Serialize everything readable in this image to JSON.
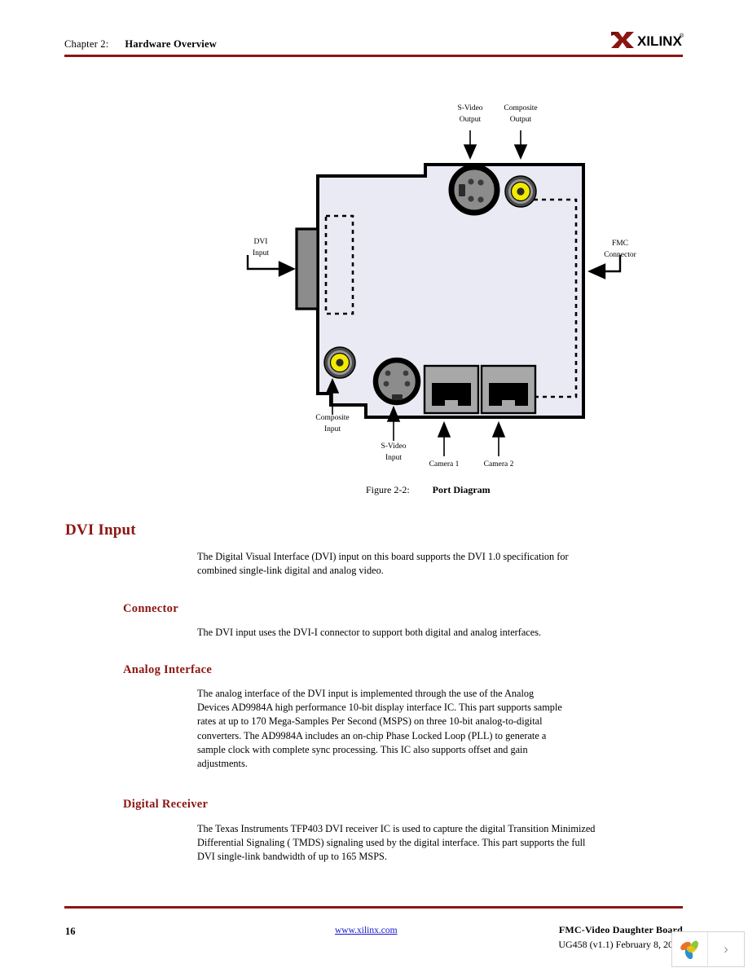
{
  "header": {
    "chapter_label": "Chapter 2:",
    "chapter_title": "Hardware Overview",
    "logo_text": "XILINX",
    "logo_trademark": "®",
    "rule_color": "#8c1512"
  },
  "figure": {
    "caption_number": "Figure 2-2:",
    "caption_title": "Port Diagram",
    "labels": {
      "svideo_output": "S-Video\nOutput",
      "composite_output": "Composite\nOutput",
      "dvi_input": "DVI\nInput",
      "fmc_connector": "FMC\nConnector",
      "composite_input": "Composite\nInput",
      "svideo_input": "S-Video\nInput",
      "camera_1": "Camera 1",
      "camera_2": "Camera 2"
    },
    "colors": {
      "board_fill": "#eaeaf5",
      "board_outline": "#000000",
      "connector_gray": "#8c8c8c",
      "rca_yellow": "#f2ea00",
      "rca_ring": "#9a9a9a",
      "jack_black": "#000000"
    }
  },
  "sections": [
    {
      "id": "dvi-input",
      "level": 1,
      "heading": "DVI Input",
      "paragraphs": [
        "The Digital Visual Interface (DVI) input on this board supports the DVI 1.0 specification for combined single-link digital and analog video."
      ]
    },
    {
      "id": "connector",
      "level": 2,
      "heading": "Connector",
      "paragraphs": [
        "The DVI input uses the DVI-I connector to support both digital and analog interfaces."
      ]
    },
    {
      "id": "analog-interface",
      "level": 2,
      "heading": "Analog Interface",
      "paragraphs": [
        "The analog interface of the DVI input is implemented through the use of the Analog Devices AD9984A high performance 10-bit display interface IC. This part supports sample rates at up to 170 Mega-Samples Per Second (MSPS) on three 10-bit analog-to-digital converters. The AD9984A includes an on-chip Phase Locked Loop (PLL) to generate a sample clock with complete sync processing. This IC also supports offset and gain adjustments."
      ]
    },
    {
      "id": "digital-receiver",
      "level": 2,
      "heading": "Digital Receiver",
      "paragraphs": [
        "The Texas Instruments TFP403 DVI receiver IC is used to capture the digital Transition Minimized Differential Signaling (            TMDS) signaling used by the digital interface. This part supports the full DVI single-link bandwidth of up to 165 MSPS."
      ]
    }
  ],
  "footer": {
    "page_number": "16",
    "url": "www.xilinx.com",
    "doc_title": "FMC-Video  Daughter Board",
    "doc_revision": "UG458 (v1.1) February 8, 2008",
    "rule_color": "#8c1512",
    "url_color": "#1414cc"
  },
  "viewer": {
    "next_chevron": "›"
  }
}
